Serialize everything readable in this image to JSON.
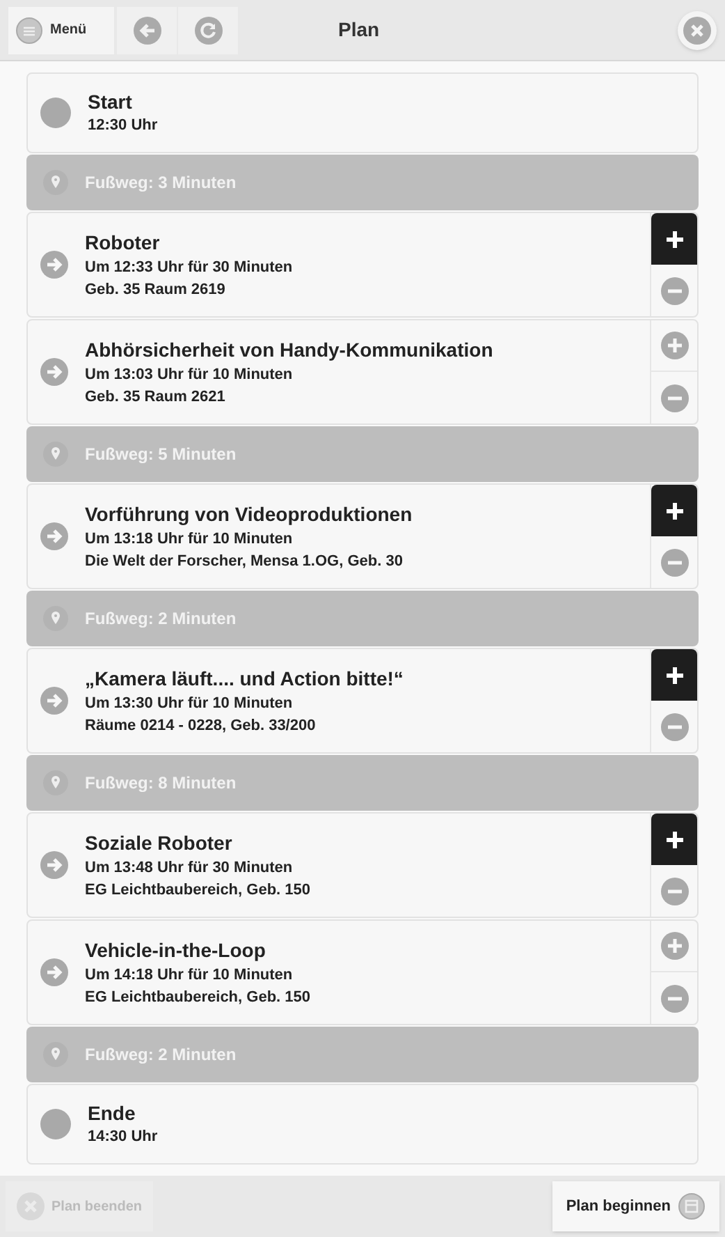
{
  "header": {
    "menu_label": "Menü",
    "title": "Plan"
  },
  "items": [
    {
      "kind": "endpoint",
      "title": "Start",
      "time": "12:30 Uhr"
    },
    {
      "kind": "walk",
      "label": "Fußweg: 3 Minuten"
    },
    {
      "kind": "event",
      "title": "Roboter",
      "time": "Um 12:33 Uhr für 30 Minuten",
      "place": "Geb. 35 Raum 2619",
      "selected": true
    },
    {
      "kind": "event",
      "title": "Abhörsicherheit von Handy-Kommunikation",
      "time": "Um 13:03 Uhr für 10 Minuten",
      "place": "Geb. 35 Raum 2621",
      "selected": false
    },
    {
      "kind": "walk",
      "label": "Fußweg: 5 Minuten"
    },
    {
      "kind": "event",
      "title": "Vorführung von Videoproduktionen",
      "time": "Um 13:18 Uhr für 10 Minuten",
      "place": "Die Welt der Forscher, Mensa 1.OG, Geb. 30",
      "selected": true
    },
    {
      "kind": "walk",
      "label": "Fußweg: 2 Minuten"
    },
    {
      "kind": "event",
      "title": "„Kamera läuft.... und Action bitte!“",
      "time": "Um 13:30 Uhr für 10 Minuten",
      "place": "Räume 0214 - 0228, Geb. 33/200",
      "selected": true
    },
    {
      "kind": "walk",
      "label": "Fußweg: 8 Minuten"
    },
    {
      "kind": "event",
      "title": "Soziale Roboter",
      "time": "Um 13:48 Uhr für 30 Minuten",
      "place": "EG Leichtbaubereich, Geb. 150",
      "selected": true
    },
    {
      "kind": "event",
      "title": "Vehicle-in-the-Loop",
      "time": "Um 14:18 Uhr für 10 Minuten",
      "place": "EG Leichtbaubereich, Geb. 150",
      "selected": false
    },
    {
      "kind": "walk",
      "label": "Fußweg: 2 Minuten"
    },
    {
      "kind": "endpoint",
      "title": "Ende",
      "time": "14:30 Uhr"
    }
  ],
  "footer": {
    "end_button": {
      "label": "Plan beenden",
      "disabled": true
    },
    "start_button": {
      "label": "Plan beginnen",
      "disabled": false
    }
  }
}
